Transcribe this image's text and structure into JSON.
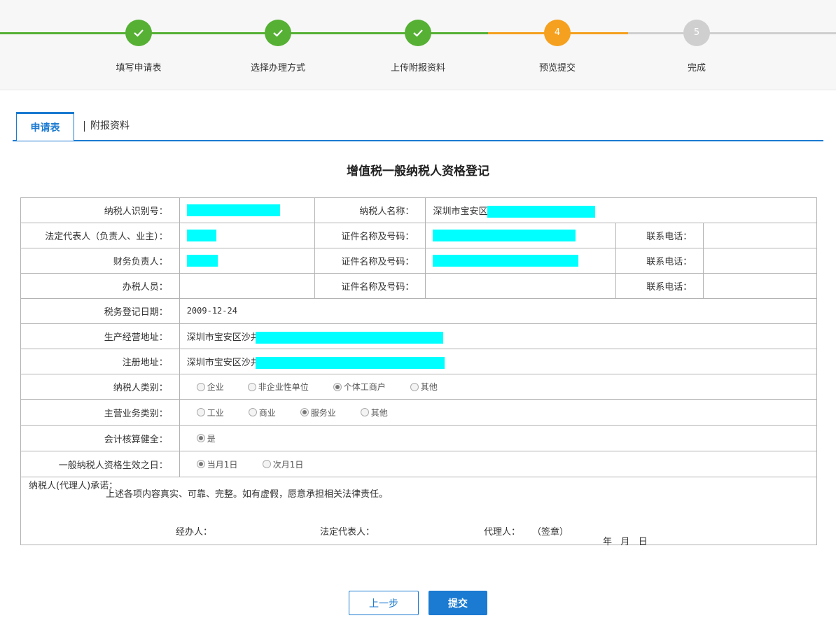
{
  "steps": [
    {
      "label": "填写申请表",
      "status": "done"
    },
    {
      "label": "选择办理方式",
      "status": "done"
    },
    {
      "label": "上传附报资料",
      "status": "done"
    },
    {
      "label": "预览提交",
      "status": "active",
      "number": "4"
    },
    {
      "label": "完成",
      "status": "todo",
      "number": "5"
    }
  ],
  "colors": {
    "done": "#55b034",
    "active": "#f5a01e",
    "todo": "#cfcfcf",
    "primary": "#1b7ad1",
    "redaction": "#00ffff"
  },
  "tabs": {
    "active": "申请表",
    "other": "附报资料"
  },
  "form": {
    "title": "增值税一般纳税人资格登记",
    "taxpayer_id_label": "纳税人识别号：",
    "taxpayer_name_label": "纳税人名称：",
    "taxpayer_name_value": "深圳市宝安区",
    "legal_rep_label": "法定代表人（负责人、业主）：",
    "id_label": "证件名称及号码：",
    "phone_label": "联系电话：",
    "finance_label": "财务负责人：",
    "agent_label": "办税人员：",
    "reg_date_label": "税务登记日期：",
    "reg_date_value": "2009-12-24",
    "biz_addr_label": "生产经营地址：",
    "biz_addr_value": "深圳市宝安区沙井",
    "reg_addr_label": "注册地址：",
    "reg_addr_value": "深圳市宝安区沙井",
    "taxpayer_type_label": "纳税人类别：",
    "taxpayer_type_options": [
      "企业",
      "非企业性单位",
      "个体工商户",
      "其他"
    ],
    "taxpayer_type_selected": "个体工商户",
    "business_type_label": "主营业务类别：",
    "business_type_options": [
      "工业",
      "商业",
      "服务业",
      "其他"
    ],
    "business_type_selected": "服务业",
    "accounting_label": "会计核算健全：",
    "accounting_option": "是",
    "effective_label": "一般纳税人资格生效之日：",
    "effective_options": [
      "当月1日",
      "次月1日"
    ],
    "effective_selected": "当月1日",
    "pledge_title": "纳税人(代理人)承诺：",
    "pledge_text": "上述各项内容真实、可靠、完整。如有虚假，愿意承担相关法律责任。",
    "handler_label": "经办人：",
    "legal_label": "法定代表人：",
    "proxy_label": "代理人：",
    "seal_label": "（签章）",
    "date_label": "年   月   日"
  },
  "buttons": {
    "prev": "上一步",
    "submit": "提交"
  }
}
